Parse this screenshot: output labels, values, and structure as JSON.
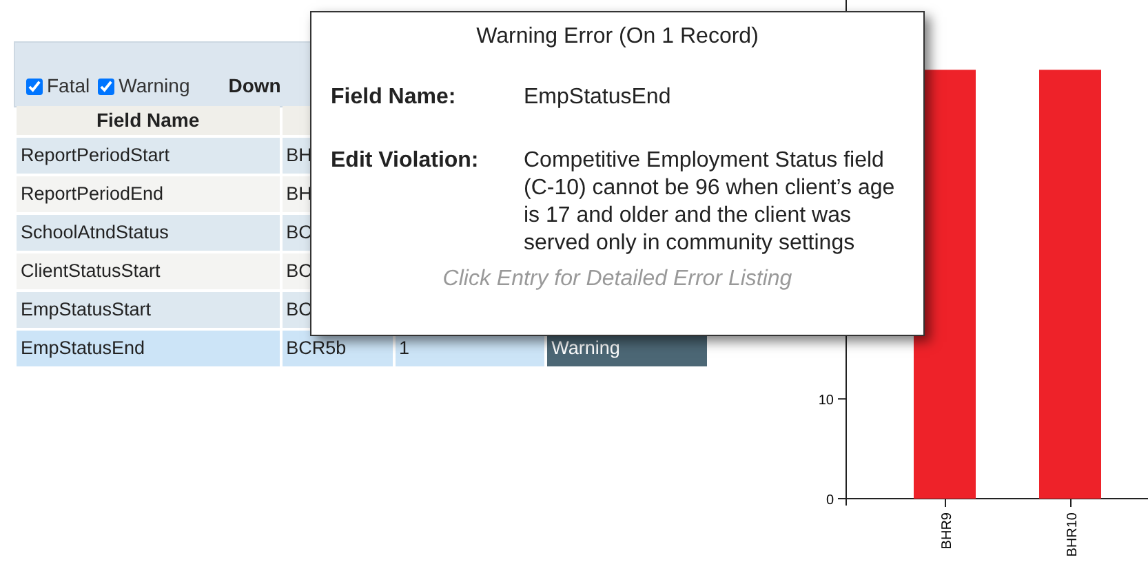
{
  "filters": [
    {
      "label": "Fatal",
      "checked": true
    },
    {
      "label": "Warning",
      "checked": true
    }
  ],
  "download_label": "Down",
  "table": {
    "columns": [
      "Field Name"
    ],
    "rows": [
      {
        "field_name": "ReportPeriodStart",
        "code": "BH",
        "count": "",
        "type": "",
        "selected": false
      },
      {
        "field_name": "ReportPeriodEnd",
        "code": "BH",
        "count": "",
        "type": "",
        "selected": false
      },
      {
        "field_name": "SchoolAtndStatus",
        "code": "BC",
        "count": "",
        "type": "",
        "selected": false
      },
      {
        "field_name": "ClientStatusStart",
        "code": "BC",
        "count": "",
        "type": "",
        "selected": false
      },
      {
        "field_name": "EmpStatusStart",
        "code": "BC",
        "count": "",
        "type": "",
        "selected": false
      },
      {
        "field_name": "EmpStatusEnd",
        "code": "BCR5b",
        "count": "1",
        "type": "Warning",
        "selected": true
      }
    ]
  },
  "tooltip": {
    "title": "Warning Error (On 1 Record)",
    "fields": [
      {
        "label": "Field Name:",
        "value": "EmpStatusEnd"
      },
      {
        "label": "Edit Violation:",
        "value": "Competitive Employment Status field (C-10) cannot be 96 when client’s age is 17 and older and the client was served only in community settings"
      }
    ],
    "footer": "Click Entry for Detailed Error Listing"
  },
  "chart": {
    "chart_data": {
      "type": "bar",
      "categories": [
        "BHR9",
        "BHR10"
      ],
      "series": [
        {
          "color": "#ee2229",
          "values": [
            43,
            43
          ]
        }
      ],
      "ylim": [
        0,
        50
      ],
      "yticks": [
        0,
        10
      ]
    }
  }
}
